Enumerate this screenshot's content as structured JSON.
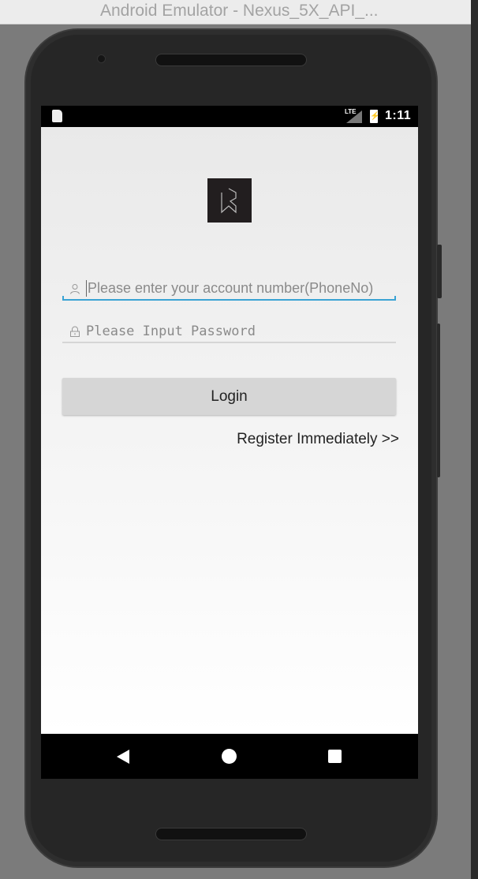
{
  "window": {
    "title": "Android Emulator - Nexus_5X_API_..."
  },
  "status_bar": {
    "network": "LTE",
    "time": "1:11",
    "icons": [
      "sd-card-icon",
      "signal-icon",
      "battery-charging-icon"
    ]
  },
  "login_form": {
    "account_placeholder": "Please enter your account number(PhoneNo)",
    "password_placeholder": "Please Input Password",
    "login_label": "Login",
    "register_link": "Register Immediately >>",
    "accent_color": "#3aa3d4"
  },
  "nav_bar": {
    "icons": [
      "back-icon",
      "home-icon",
      "recents-icon"
    ]
  }
}
